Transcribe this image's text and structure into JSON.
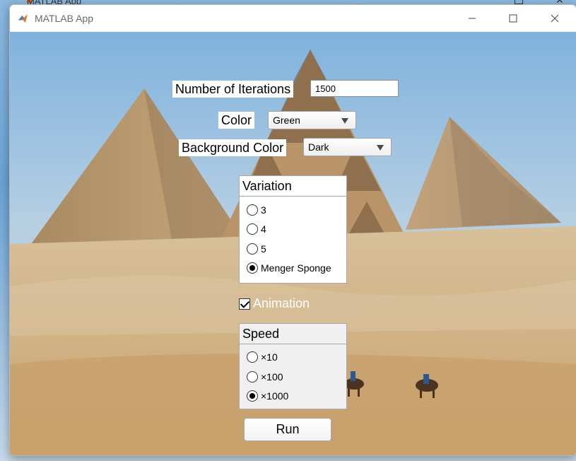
{
  "window": {
    "title": "MATLAB App",
    "behind_title": "MATLAB App"
  },
  "form": {
    "iterations_label": "Number of Iterations",
    "iterations_value": "1500",
    "color_label": "Color",
    "color_value": "Green",
    "background_label": "Background Color",
    "background_value": "Dark",
    "variation": {
      "title": "Variation",
      "options": [
        "3",
        "4",
        "5",
        "Menger Sponge"
      ],
      "selected": "Menger Sponge"
    },
    "animation": {
      "label": "Animation",
      "checked": true
    },
    "speed": {
      "title": "Speed",
      "options": [
        "×10",
        "×100",
        "×1000"
      ],
      "selected": "×1000"
    },
    "run_label": "Run"
  },
  "icons": [
    "matlab-logo-icon",
    "minimize-icon",
    "maximize-icon",
    "close-icon",
    "caret-down-icon"
  ],
  "colors": {
    "sky": "#86b6df",
    "sand": "#c9a876",
    "pyramid": "#b8956a"
  }
}
